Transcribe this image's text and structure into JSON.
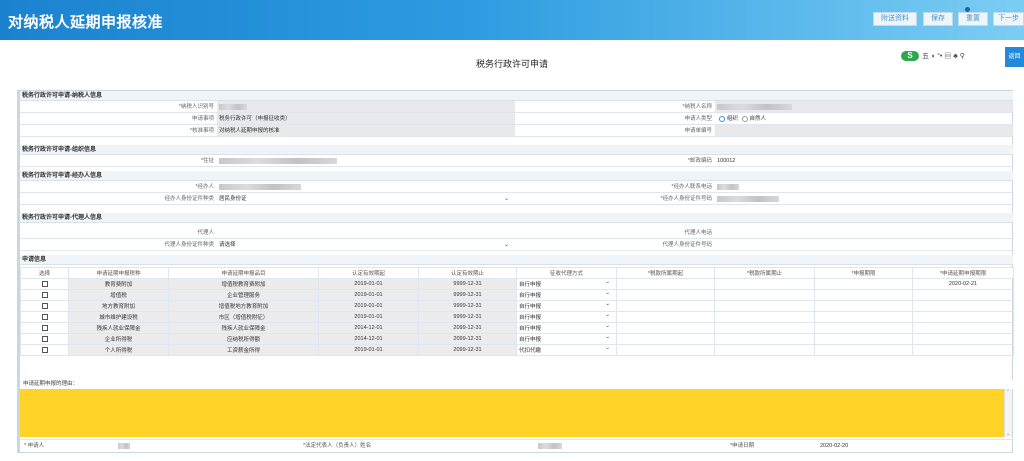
{
  "header": {
    "title": "对纳税人延期申报核准",
    "buttons": {
      "attachments": "附送资料",
      "save": "保存",
      "reset": "重置",
      "next": "下一步"
    }
  },
  "page_title": "税务行政许可申请",
  "toolbar": {
    "badge": "S",
    "glyphs": "五 ◗ °• ▤ ♣ ⚲",
    "back_button": "返回"
  },
  "taxpayer": {
    "section": "税务行政许可申请-纳税人信息",
    "id_label": "*纳税人识别号",
    "name_label": "*纳税人名称",
    "item_label": "申请事项",
    "item_value": "税务行政许可（申报征收类）",
    "type_label": "申请人类型",
    "type_options": [
      "组织",
      "自然人"
    ],
    "approval_label": "*核准事项",
    "approval_value": "对纳税人延期申报的核准",
    "doc_label": "申请单编号"
  },
  "org": {
    "section": "税务行政许可申请-组织信息",
    "address_label": "*住址",
    "postcode_label": "*邮政编码",
    "postcode_value": "100012"
  },
  "agent": {
    "section": "税务行政许可申请-经办人信息",
    "name_label": "*经办人",
    "phone_label": "*经办人联系电话",
    "idtype_label": "经办人身份证件种类",
    "idtype_value": "居民身份证",
    "idno_label": "*经办人身份证件号码"
  },
  "proxy": {
    "section": "税务行政许可申请-代理人信息",
    "name_label": "代理人",
    "phone_label": "代理人电话",
    "idtype_label": "代理人身份证件种类",
    "idtype_value": "请选择",
    "idno_label": "代理人身份证件号码"
  },
  "apply": {
    "section": "申请信息",
    "columns": [
      "选择",
      "申请延期申报税种",
      "申请延期申报品目",
      "认定有效期起",
      "认定有效期止",
      "征收代理方式",
      "*税款所属期起",
      "*税款所属期止",
      "*申报期限",
      "*申请延期申报期限"
    ],
    "rows": [
      {
        "tax": "教育费附加",
        "item": "增值税教育费附加",
        "start": "2019-01-01",
        "end": "9999-12-31",
        "mode": "自行申报",
        "deadline": "2020-02-21"
      },
      {
        "tax": "增值税",
        "item": "企业管理服务",
        "start": "2019-01-01",
        "end": "9999-12-31",
        "mode": "自行申报",
        "deadline": ""
      },
      {
        "tax": "地方教育附加",
        "item": "增值税地方教育附加",
        "start": "2019-01-01",
        "end": "9999-12-31",
        "mode": "自行申报",
        "deadline": ""
      },
      {
        "tax": "城市维护建设税",
        "item": "市区（增值税附征）",
        "start": "2019-01-01",
        "end": "9999-12-31",
        "mode": "自行申报",
        "deadline": ""
      },
      {
        "tax": "残疾人就业保障金",
        "item": "残疾人就业保障金",
        "start": "2014-12-01",
        "end": "2099-12-31",
        "mode": "自行申报",
        "deadline": ""
      },
      {
        "tax": "企业所得税",
        "item": "应纳税所得额",
        "start": "2014-12-01",
        "end": "2099-12-31",
        "mode": "自行申报",
        "deadline": ""
      },
      {
        "tax": "个人所得税",
        "item": "工资薪金所得",
        "start": "2019-01-01",
        "end": "2099-12-31",
        "mode": "代扣代缴",
        "deadline": ""
      }
    ],
    "reason_label": "申请延期申报的理由："
  },
  "footer": {
    "applicant_label": "* 申请人",
    "legal_label": "*法定代表人（负责人）姓名",
    "date_label": "*申请日期",
    "date_value": "2020-02-20"
  },
  "colors": {
    "header_start": "#1b82cf",
    "header_end": "#7ccdf3",
    "reason_fill": "#ffd427",
    "accent": "#2389db"
  }
}
